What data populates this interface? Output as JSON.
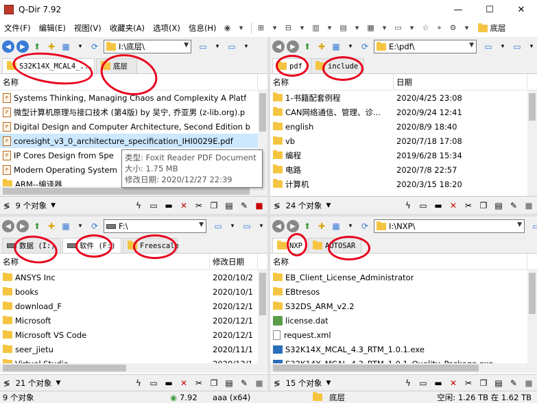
{
  "window": {
    "title": "Q-Dir 7.92",
    "minimize": "—",
    "maximize": "☐",
    "close": "✕"
  },
  "menu": {
    "items": [
      "文件(F)",
      "编辑(E)",
      "视图(V)",
      "收藏夹(A)",
      "选项(X)",
      "信息(H)"
    ],
    "right_label": "底层"
  },
  "panes": {
    "tl": {
      "path": "I:\\底层\\",
      "tabs": [
        "S32K14X_MCAL4_...",
        "底层"
      ],
      "columns": [
        "名称"
      ],
      "rows": [
        "Systems Thinking, Managing Chaos and Complexity A Platf",
        "微型计算机原理与接口技术 (第4版) by 吴宁, 乔亚男 (z-lib.org).p",
        "Digital Design and Computer Architecture, Second Edition b",
        "coresight_v3_0_architecture_specification_IHI0029E.pdf",
        "IP Cores Design from Spe",
        "Modern Operating System",
        "ARM--编译器"
      ],
      "status": "9 个对象"
    },
    "tr": {
      "path": "E:\\pdf\\",
      "tabs": [
        "pdf",
        "include"
      ],
      "columns": [
        "名称",
        "日期"
      ],
      "rows": [
        {
          "name": "1-书籍配套例程",
          "date": "2020/4/25 23:08"
        },
        {
          "name": "CAN网络通信、管理、诊...",
          "date": "2020/9/24 12:41"
        },
        {
          "name": "english",
          "date": "2020/8/9 18:40"
        },
        {
          "name": "vb",
          "date": "2020/7/18 17:08"
        },
        {
          "name": "编程",
          "date": "2019/6/28 15:34"
        },
        {
          "name": "电路",
          "date": "2020/7/8 22:57"
        },
        {
          "name": "计算机",
          "date": "2020/3/15 18:20"
        }
      ],
      "status": "24 个对象"
    },
    "bl": {
      "path": "F:\\",
      "tabs": [
        "数据 (I:)",
        "软件 (F:)",
        "Freescale"
      ],
      "columns": [
        "名称",
        "修改日期"
      ],
      "rows": [
        {
          "name": "ANSYS Inc",
          "date": "2020/10/2"
        },
        {
          "name": "books",
          "date": "2020/10/1"
        },
        {
          "name": "download_F",
          "date": "2020/12/1"
        },
        {
          "name": "Microsoft",
          "date": "2020/12/1"
        },
        {
          "name": "Microsoft VS Code",
          "date": "2020/12/1"
        },
        {
          "name": "seer_jietu",
          "date": "2020/11/1"
        },
        {
          "name": "Virtual Studio",
          "date": "2020/12/1"
        }
      ],
      "status": "21 个对象"
    },
    "br": {
      "path": "I:\\NXP\\",
      "tabs": [
        "NXP",
        "AUTOSAR"
      ],
      "columns": [
        "名称"
      ],
      "rows": [
        "EB_Client_License_Administrator",
        "EBtresos",
        "S32DS_ARM_v2.2",
        "license.dat",
        "request.xml",
        "S32K14X_MCAL_4.3_RTM_1.0.1.exe",
        "S32K14X_MCAL_4.3_RTM_1.0.1_Quality_Package.exe"
      ],
      "status": "15 个对象"
    }
  },
  "tooltip": {
    "line1": "类型: Foxit Reader PDF Document",
    "line2": "大小: 1.75 MB",
    "line3": "修改日期: 2020/12/27 22:39"
  },
  "bottom": {
    "left": "9 个对象",
    "version": "7.92",
    "build": "aaa (x64)",
    "folder": "底层",
    "space": "空闲: 1.26 TB 在 1.62 TB"
  },
  "colors": {
    "accent": "#3a7bd5",
    "selection": "#cce8ff",
    "annotation": "#e8001c"
  },
  "icons": {
    "back": "back-arrow-icon",
    "forward": "forward-arrow-icon",
    "up": "folder-up-icon",
    "refresh": "refresh-icon",
    "cut": "scissors-icon",
    "delete": "delete-x-icon"
  }
}
